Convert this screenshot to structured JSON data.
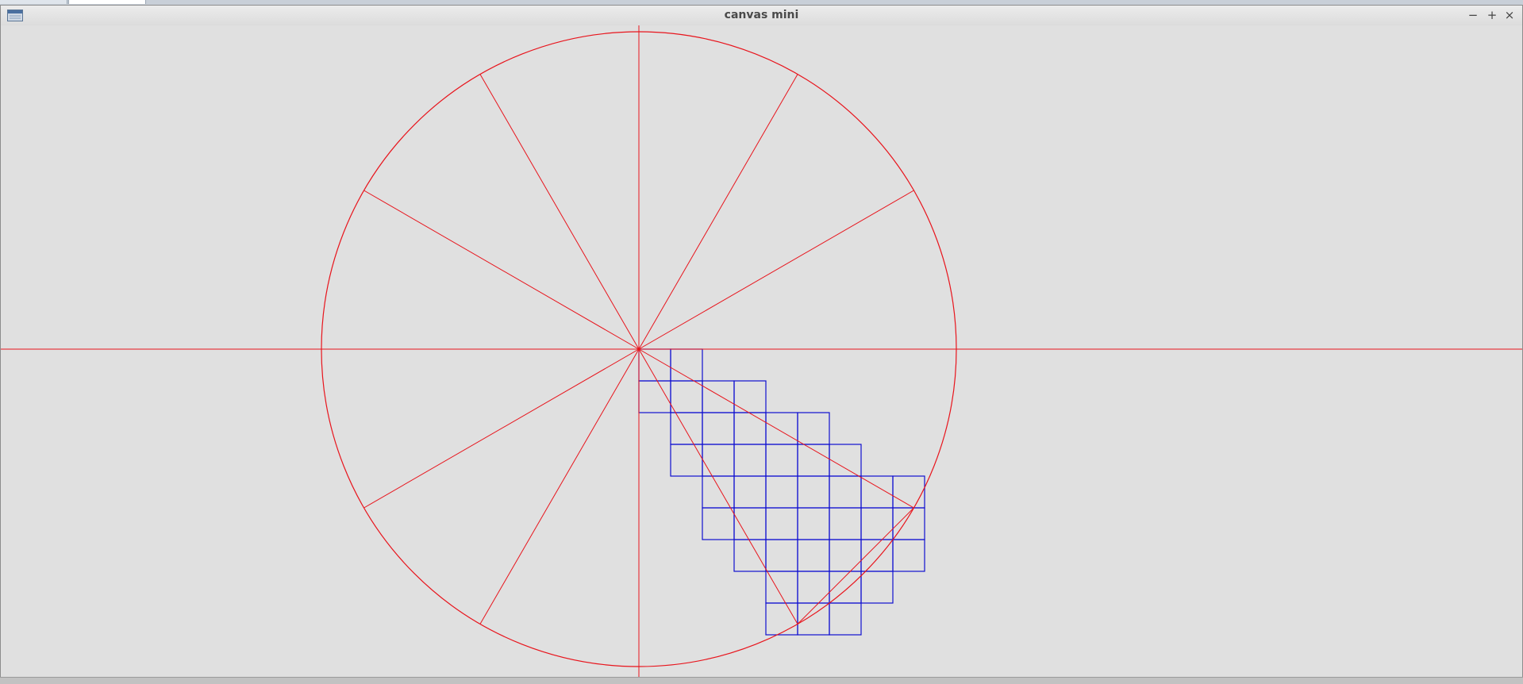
{
  "window": {
    "title": "canvas mini",
    "buttons": {
      "minimize": "−",
      "maximize": "+",
      "close": "×"
    },
    "icon": "window-menu-icon"
  },
  "canvas": {
    "background": "#e0e0e0",
    "axis_color": "#e8141c",
    "grid_color": "#1010d0",
    "spokes_degrees": [
      30,
      60,
      90,
      120,
      150,
      180,
      210,
      240,
      270,
      300,
      330,
      360
    ],
    "wedge_degrees": [
      300,
      330
    ],
    "pixel_cells": [
      [
        0,
        0
      ],
      [
        1,
        0
      ],
      [
        0,
        1
      ],
      [
        1,
        1
      ],
      [
        2,
        1
      ],
      [
        3,
        1
      ],
      [
        1,
        2
      ],
      [
        2,
        2
      ],
      [
        3,
        2
      ],
      [
        4,
        2
      ],
      [
        5,
        2
      ],
      [
        1,
        3
      ],
      [
        2,
        3
      ],
      [
        3,
        3
      ],
      [
        4,
        3
      ],
      [
        5,
        3
      ],
      [
        6,
        3
      ],
      [
        2,
        4
      ],
      [
        3,
        4
      ],
      [
        4,
        4
      ],
      [
        5,
        4
      ],
      [
        6,
        4
      ],
      [
        7,
        4
      ],
      [
        8,
        4
      ],
      [
        2,
        5
      ],
      [
        3,
        5
      ],
      [
        4,
        5
      ],
      [
        5,
        5
      ],
      [
        6,
        5
      ],
      [
        7,
        5
      ],
      [
        8,
        5
      ],
      [
        3,
        6
      ],
      [
        4,
        6
      ],
      [
        5,
        6
      ],
      [
        6,
        6
      ],
      [
        7,
        6
      ],
      [
        8,
        6
      ],
      [
        4,
        7
      ],
      [
        5,
        7
      ],
      [
        6,
        7
      ],
      [
        7,
        7
      ],
      [
        4,
        8
      ],
      [
        5,
        8
      ],
      [
        6,
        8
      ]
    ]
  }
}
